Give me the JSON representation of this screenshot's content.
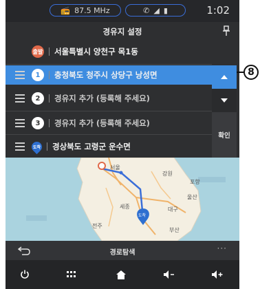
{
  "status": {
    "radio": "87.5 MHz",
    "time": "1:02"
  },
  "header": {
    "title": "경유지 설정"
  },
  "route": {
    "origin": {
      "label": "서울특별시 양천구 목1동",
      "badge": "출발"
    },
    "waypoints": [
      {
        "index": "1",
        "label": "충청북도 청주시 상당구 낭성면",
        "selected": true
      },
      {
        "index": "2",
        "label": "경유지 추가 (등록해 주세요)",
        "selected": false
      },
      {
        "index": "3",
        "label": "경유지 추가 (등록해 주세요)",
        "selected": false
      }
    ],
    "destination": {
      "label": "경상북도 고령군 운수면",
      "badge": "도착"
    }
  },
  "side_panel": {
    "up_icon": "triangle-up-icon",
    "down_icon": "triangle-down-icon",
    "confirm_label": "확인"
  },
  "map": {
    "labels": [
      "서울",
      "세종",
      "도착",
      "대구",
      "울산",
      "부산",
      "전주",
      "강원",
      "포항"
    ]
  },
  "bottom": {
    "route_search_label": "경로탐색",
    "more_label": "···"
  },
  "callout": {
    "number": "8"
  },
  "colors": {
    "accent": "#3f8de0",
    "background": "#2e2f31",
    "origin_badge": "#e0694a",
    "destination_badge": "#2e6fd0"
  }
}
